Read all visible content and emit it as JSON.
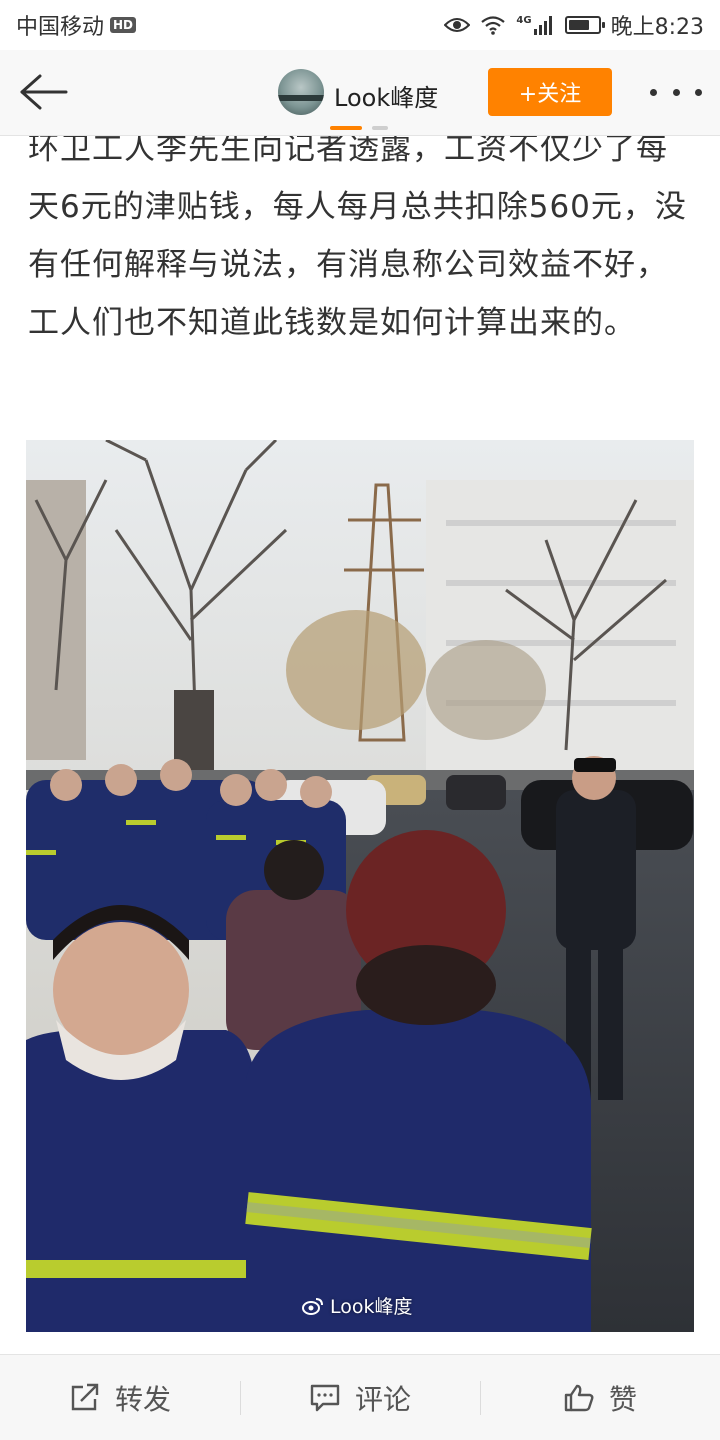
{
  "status_bar": {
    "carrier": "中国移动",
    "hd_badge": "HD",
    "network": "4G",
    "time": "晚上8:23",
    "battery_level": 0.7,
    "icons": [
      "eye-icon",
      "wifi-icon",
      "signal-icon",
      "battery-icon"
    ]
  },
  "header": {
    "back_icon": "back-arrow-icon",
    "account_name": "Look峰度",
    "follow_label": "+关注",
    "more_icon": "more-dots-icon",
    "accent_color": "#ff8200"
  },
  "article": {
    "paragraph": "环卫工人李先生向记者透露，工资不仅少了每天6元的津贴钱，每人每月总共扣除560元，没有任何解释与说法，有消息称公司效益不好，工人们也不知道此钱数是如何计算出来的。",
    "photo": {
      "description_icon": "photo-street-protest",
      "watermark": "Look峰度",
      "watermark_icon": "weibo-logo-icon"
    }
  },
  "toolbar": {
    "repost_label": "转发",
    "comment_label": "评论",
    "like_label": "赞",
    "repost_icon": "share-icon",
    "comment_icon": "comment-icon",
    "like_icon": "thumbs-up-icon"
  }
}
